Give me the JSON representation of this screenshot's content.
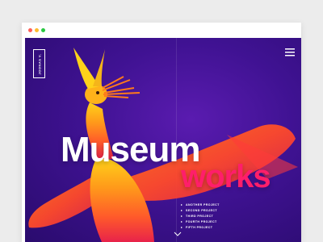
{
  "window": {
    "controls": [
      "close",
      "minimize",
      "maximize"
    ]
  },
  "brand": {
    "logo_text": "JOONAS V."
  },
  "hero": {
    "line1": "Museum",
    "line2": "works"
  },
  "projects": [
    {
      "label": "Another project"
    },
    {
      "label": "Second project"
    },
    {
      "label": "Third project"
    },
    {
      "label": "Fourth project"
    },
    {
      "label": "Fifth project"
    }
  ],
  "icons": {
    "menu": "hamburger-menu-icon",
    "scroll": "chevron-down-icon"
  },
  "colors": {
    "accent": "#ff1e6a",
    "background_purple": "#3f1292",
    "bird_orange": "#f58a1f"
  }
}
